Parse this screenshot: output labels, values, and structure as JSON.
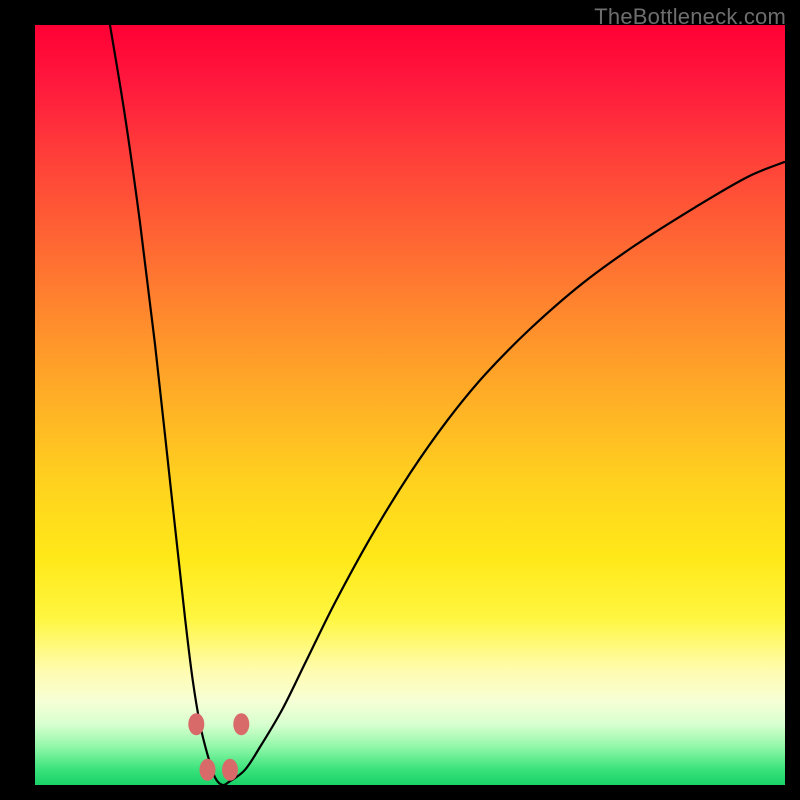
{
  "watermark": "TheBottleneck.com",
  "chart_data": {
    "type": "line",
    "title": "",
    "xlabel": "",
    "ylabel": "",
    "xlim": [
      0,
      100
    ],
    "ylim": [
      0,
      100
    ],
    "series": [
      {
        "name": "bottleneck-curve",
        "x": [
          10,
          12,
          14,
          16,
          18,
          20,
          21,
          22,
          23,
          24,
          25,
          26,
          28,
          30,
          33,
          36,
          40,
          45,
          50,
          55,
          60,
          66,
          73,
          80,
          88,
          95,
          100
        ],
        "y": [
          100,
          88,
          74,
          58,
          40,
          22,
          14,
          8,
          4,
          1,
          0,
          0.5,
          2,
          5,
          10,
          16,
          24,
          33,
          41,
          48,
          54,
          60,
          66,
          71,
          76,
          80,
          82
        ]
      }
    ],
    "markers": [
      {
        "x": 21.5,
        "y": 8
      },
      {
        "x": 27.5,
        "y": 8
      },
      {
        "x": 23.0,
        "y": 2
      },
      {
        "x": 26.0,
        "y": 2
      }
    ],
    "gradient_note": "background encodes bottleneck severity: top=red (bad), bottom=green (good); curve minimum ≈ optimal"
  }
}
